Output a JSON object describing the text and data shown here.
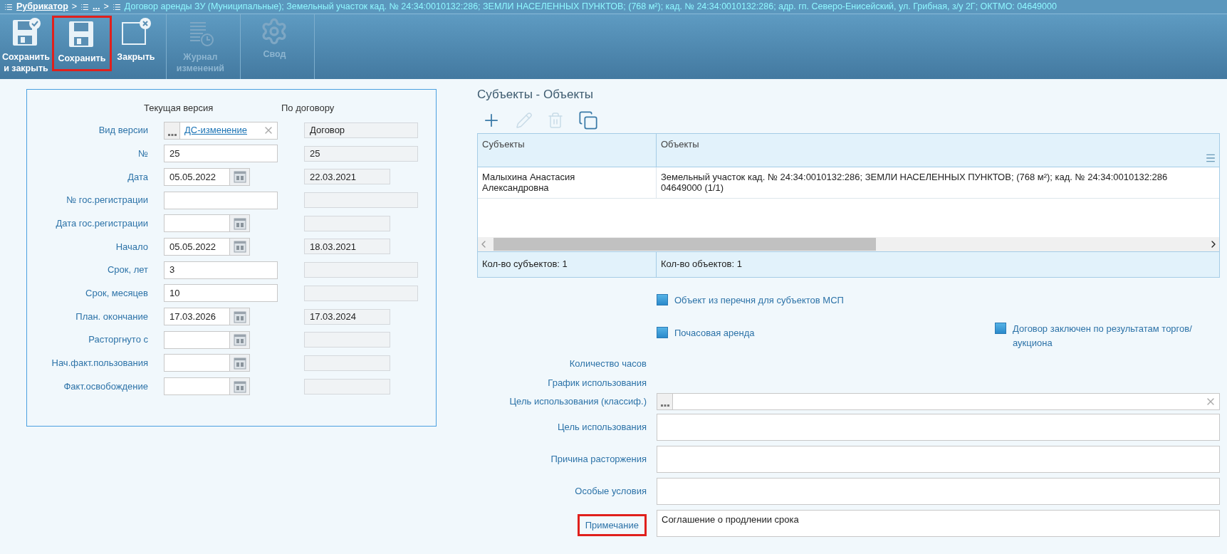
{
  "breadcrumb": {
    "root": "Рубрикатор",
    "separator_1": ">",
    "middle": "...",
    "separator_2": ">",
    "title": "Договор аренды ЗУ (Муниципальные); Земельный участок кад. № 24:34:0010132:286; ЗЕМЛИ НАСЕЛЕННЫХ ПУНКТОВ; (768 м²); кад. № 24:34:0010132:286; адр. гп. Северо-Енисейский, ул. Грибная, з/у 2Г; ОКТМО: 04649000"
  },
  "toolbar": [
    {
      "kind": "save_close",
      "label": "Сохранить\nи закрыть",
      "disabled": false,
      "highlighted": false
    },
    {
      "kind": "save",
      "label": "Сохранить",
      "disabled": false,
      "highlighted": true
    },
    {
      "kind": "close",
      "label": "Закрыть",
      "disabled": false,
      "highlighted": false
    },
    {
      "kind": "journal",
      "label": "Журнал\nизменений",
      "disabled": true,
      "highlighted": false
    },
    {
      "kind": "summary",
      "label": "Свод",
      "disabled": true,
      "highlighted": false
    }
  ],
  "version_form": {
    "column_headers": [
      "Текущая версия",
      "По договору"
    ],
    "rows": [
      {
        "label": "Вид версии",
        "kind": "lookup",
        "value": "ДС-изменение",
        "contract_value": "Договор"
      },
      {
        "label": "№",
        "kind": "text",
        "value": "25",
        "contract_value": "25"
      },
      {
        "label": "Дата",
        "kind": "date",
        "value": "05.05.2022",
        "contract_value": "22.03.2021"
      },
      {
        "label": "№ гос.регистрации",
        "kind": "text"
      },
      {
        "label": "Дата гос.регистрации",
        "kind": "date"
      },
      {
        "label": "Начало",
        "kind": "date",
        "value": "05.05.2022",
        "contract_value": "18.03.2021"
      },
      {
        "label": "Срок, лет",
        "kind": "text",
        "value": "3"
      },
      {
        "label": "Срок, месяцев",
        "kind": "text",
        "value": "10"
      },
      {
        "label": "План. окончание",
        "kind": "date",
        "value": "17.03.2026",
        "contract_value": "17.03.2024"
      },
      {
        "label": "Расторгнуто с",
        "kind": "date"
      },
      {
        "label": "Нач.факт.пользования",
        "kind": "date"
      },
      {
        "label": "Факт.освобождение",
        "kind": "date"
      }
    ]
  },
  "subjects_objects": {
    "title": "Субъекты - Объекты",
    "tools": [
      {
        "kind": "add",
        "disabled": false
      },
      {
        "kind": "edit",
        "disabled": true
      },
      {
        "kind": "delete",
        "disabled": true
      },
      {
        "kind": "copy",
        "disabled": false
      }
    ],
    "table": {
      "columns": [
        "Субъекты",
        "Объекты"
      ],
      "rows": [
        {
          "subject": "Малыхина Анастасия Александровна",
          "object": "Земельный участок кад. № 24:34:0010132:286; ЗЕМЛИ НАСЕЛЕННЫХ ПУНКТОВ; (768 м²); кад. № 24:34:0010132:286\n04649000 (1/1)"
        }
      ],
      "footer": [
        "Кол-во субъектов: 1",
        "Кол-во объектов: 1"
      ]
    }
  },
  "flags": [
    {
      "label": "Объект из перечня для субъектов МСП",
      "checked": false
    },
    {
      "label": "Почасовая аренда",
      "checked": false
    },
    {
      "label": "Договор заключен по результатам торгов/\nаукциона",
      "checked": false
    }
  ],
  "details": [
    {
      "label": "Количество часов",
      "kind": "label_only",
      "highlighted": false
    },
    {
      "label": "График использования",
      "kind": "label_only",
      "highlighted": false
    },
    {
      "label": "Цель использования (классиф.)",
      "kind": "lookup",
      "highlighted": false
    },
    {
      "label": "Цель использования",
      "kind": "textarea",
      "highlighted": false
    },
    {
      "label": "Причина расторжения",
      "kind": "textarea",
      "highlighted": false
    },
    {
      "label": "Особые условия",
      "kind": "textarea",
      "highlighted": false
    },
    {
      "label": "Примечание",
      "kind": "textarea",
      "value": "Соглашение о продлении срока",
      "highlighted": true
    }
  ]
}
